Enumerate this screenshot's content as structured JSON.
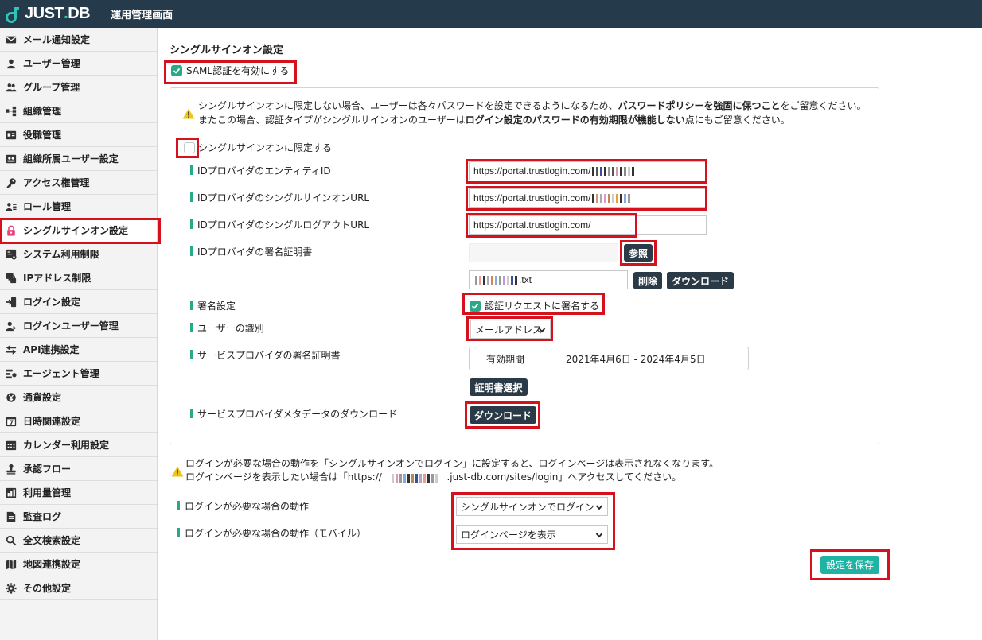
{
  "header": {
    "logo_text": "JUST",
    "logo_dot": ".",
    "logo_suffix": "DB",
    "app_title": "運用管理画面"
  },
  "sidebar": {
    "items": [
      {
        "label": "メール通知設定",
        "icon": "mail-icon"
      },
      {
        "label": "ユーザー管理",
        "icon": "user-icon"
      },
      {
        "label": "グループ管理",
        "icon": "group-icon"
      },
      {
        "label": "組織管理",
        "icon": "org-icon"
      },
      {
        "label": "役職管理",
        "icon": "id-card-icon"
      },
      {
        "label": "組織所属ユーザー設定",
        "icon": "users-card-icon"
      },
      {
        "label": "アクセス権管理",
        "icon": "key-icon"
      },
      {
        "label": "ロール管理",
        "icon": "role-icon"
      },
      {
        "label": "シングルサインオン設定",
        "icon": "lock-icon",
        "active": true
      },
      {
        "label": "システム利用制限",
        "icon": "system-icon"
      },
      {
        "label": "IPアドレス制限",
        "icon": "ip-icon"
      },
      {
        "label": "ログイン設定",
        "icon": "login-icon"
      },
      {
        "label": "ログインユーザー管理",
        "icon": "login-user-icon"
      },
      {
        "label": "API連携設定",
        "icon": "api-icon"
      },
      {
        "label": "エージェント管理",
        "icon": "agent-icon"
      },
      {
        "label": "通貨設定",
        "icon": "currency-icon"
      },
      {
        "label": "日時関連設定",
        "icon": "calendar-7-icon"
      },
      {
        "label": "カレンダー利用設定",
        "icon": "calendar-icon"
      },
      {
        "label": "承認フロー",
        "icon": "stamp-icon"
      },
      {
        "label": "利用量管理",
        "icon": "usage-icon"
      },
      {
        "label": "監査ログ",
        "icon": "document-icon"
      },
      {
        "label": "全文検索設定",
        "icon": "search-icon"
      },
      {
        "label": "地図連携設定",
        "icon": "map-icon"
      },
      {
        "label": "その他設定",
        "icon": "gear-icon"
      }
    ]
  },
  "main": {
    "title": "シングルサインオン設定",
    "saml_checkbox_label": "SAML認証を有効にする",
    "notice1": {
      "line1_a": "シングルサインオンに限定しない場合、ユーザーは各々パスワードを設定できるようになるため、",
      "line1_b": "パスワードポリシーを強固に保つこと",
      "line1_c": "をご留意ください。",
      "line2_a": "またこの場合、認証タイプがシングルサインオンのユーザーは",
      "line2_b": "ログイン設定のパスワードの有効期限が機能しない",
      "line2_c": "点にもご留意ください。"
    },
    "limit_checkbox_label": "シングルサインオンに限定する",
    "fields": {
      "entity_id_label": "IDプロバイダのエンティティID",
      "entity_id_value": "https://portal.trustlogin.com/",
      "sso_url_label": "IDプロバイダのシングルサインオンURL",
      "sso_url_value": "https://portal.trustlogin.com/",
      "slo_url_label": "IDプロバイダのシングルログアウトURL",
      "slo_url_value": "https://portal.trustlogin.com/",
      "cert_label": "IDプロバイダの署名証明書",
      "browse_button": "参照",
      "cert_file_suffix": ".txt",
      "delete_button": "削除",
      "download_button": "ダウンロード",
      "sign_label": "署名設定",
      "sign_checkbox_label": "認証リクエストに署名する",
      "user_id_label": "ユーザーの識別",
      "user_id_value": "メールアドレス",
      "sp_cert_label": "サービスプロバイダの署名証明書",
      "sp_cert_period_key": "有効期間",
      "sp_cert_period_value": "2021年4月6日 - 2024年4月5日",
      "select_cert_button": "証明書選択",
      "sp_meta_label": "サービスプロバイダメタデータのダウンロード",
      "sp_meta_button": "ダウンロード"
    },
    "notice2": {
      "line1": "ログインが必要な場合の動作を「シングルサインオンでログイン」に設定すると、ログインページは表示されなくなります。",
      "line2_a": "ログインページを表示したい場合は「https://",
      "line2_b": ".just-db.com/sites/login」へアクセスしてください。"
    },
    "login_action_label": "ログインが必要な場合の動作",
    "login_action_value": "シングルサインオンでログイン",
    "login_action_mobile_label": "ログインが必要な場合の動作（モバイル）",
    "login_action_mobile_value": "ログインページを表示",
    "save_button": "設定を保存"
  },
  "colors": {
    "accent": "#1fb3a3",
    "header_bg": "#253a4a",
    "highlight": "#d4111c",
    "check": "#2aa88a"
  }
}
